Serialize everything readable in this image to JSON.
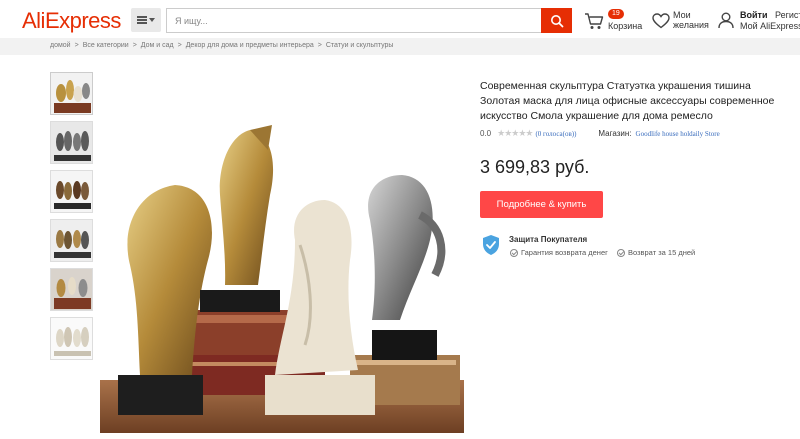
{
  "header": {
    "logo": "AliExpress",
    "search_placeholder": "Я ищу...",
    "cart_count": "19",
    "cart_label": "Корзина",
    "wishlist_label": "Мои желания",
    "account_signin": "Войти",
    "account_register": "Регист",
    "account_label": "Мой AliExpress"
  },
  "breadcrumb": [
    "домой",
    "Все категории",
    "Дом и сад",
    "Декор для дома и предметы интерьера",
    "Статуи и скульптуры"
  ],
  "product": {
    "title": "Современная скульптура Статуэтка украшения тишина Золотая маска для лица офисные аксессуары современное искусство Смола украшение для дома ремесло",
    "rating": "0.0",
    "stars": "★★★★★",
    "votes": "(0 голоса(ов))",
    "store_label": "Магазин:",
    "store_name": "Goodlife house holdaily Store",
    "price": "3 699,83 руб.",
    "buy_button": "Подробнее & купить",
    "protection_title": "Защита Покупателя",
    "guarantee_refund": "Гарантия возврата денег",
    "guarantee_return": "Возврат за 15 дней"
  },
  "colors": {
    "brand": "#e62e04",
    "buy_button": "#ff4747",
    "link": "#3a6dbd",
    "shield": "#4aa3e0"
  },
  "icons": [
    "hamburger-icon",
    "search-icon",
    "cart-icon",
    "heart-icon",
    "user-icon",
    "shield-icon",
    "check-circle-icon",
    "star-icon"
  ]
}
